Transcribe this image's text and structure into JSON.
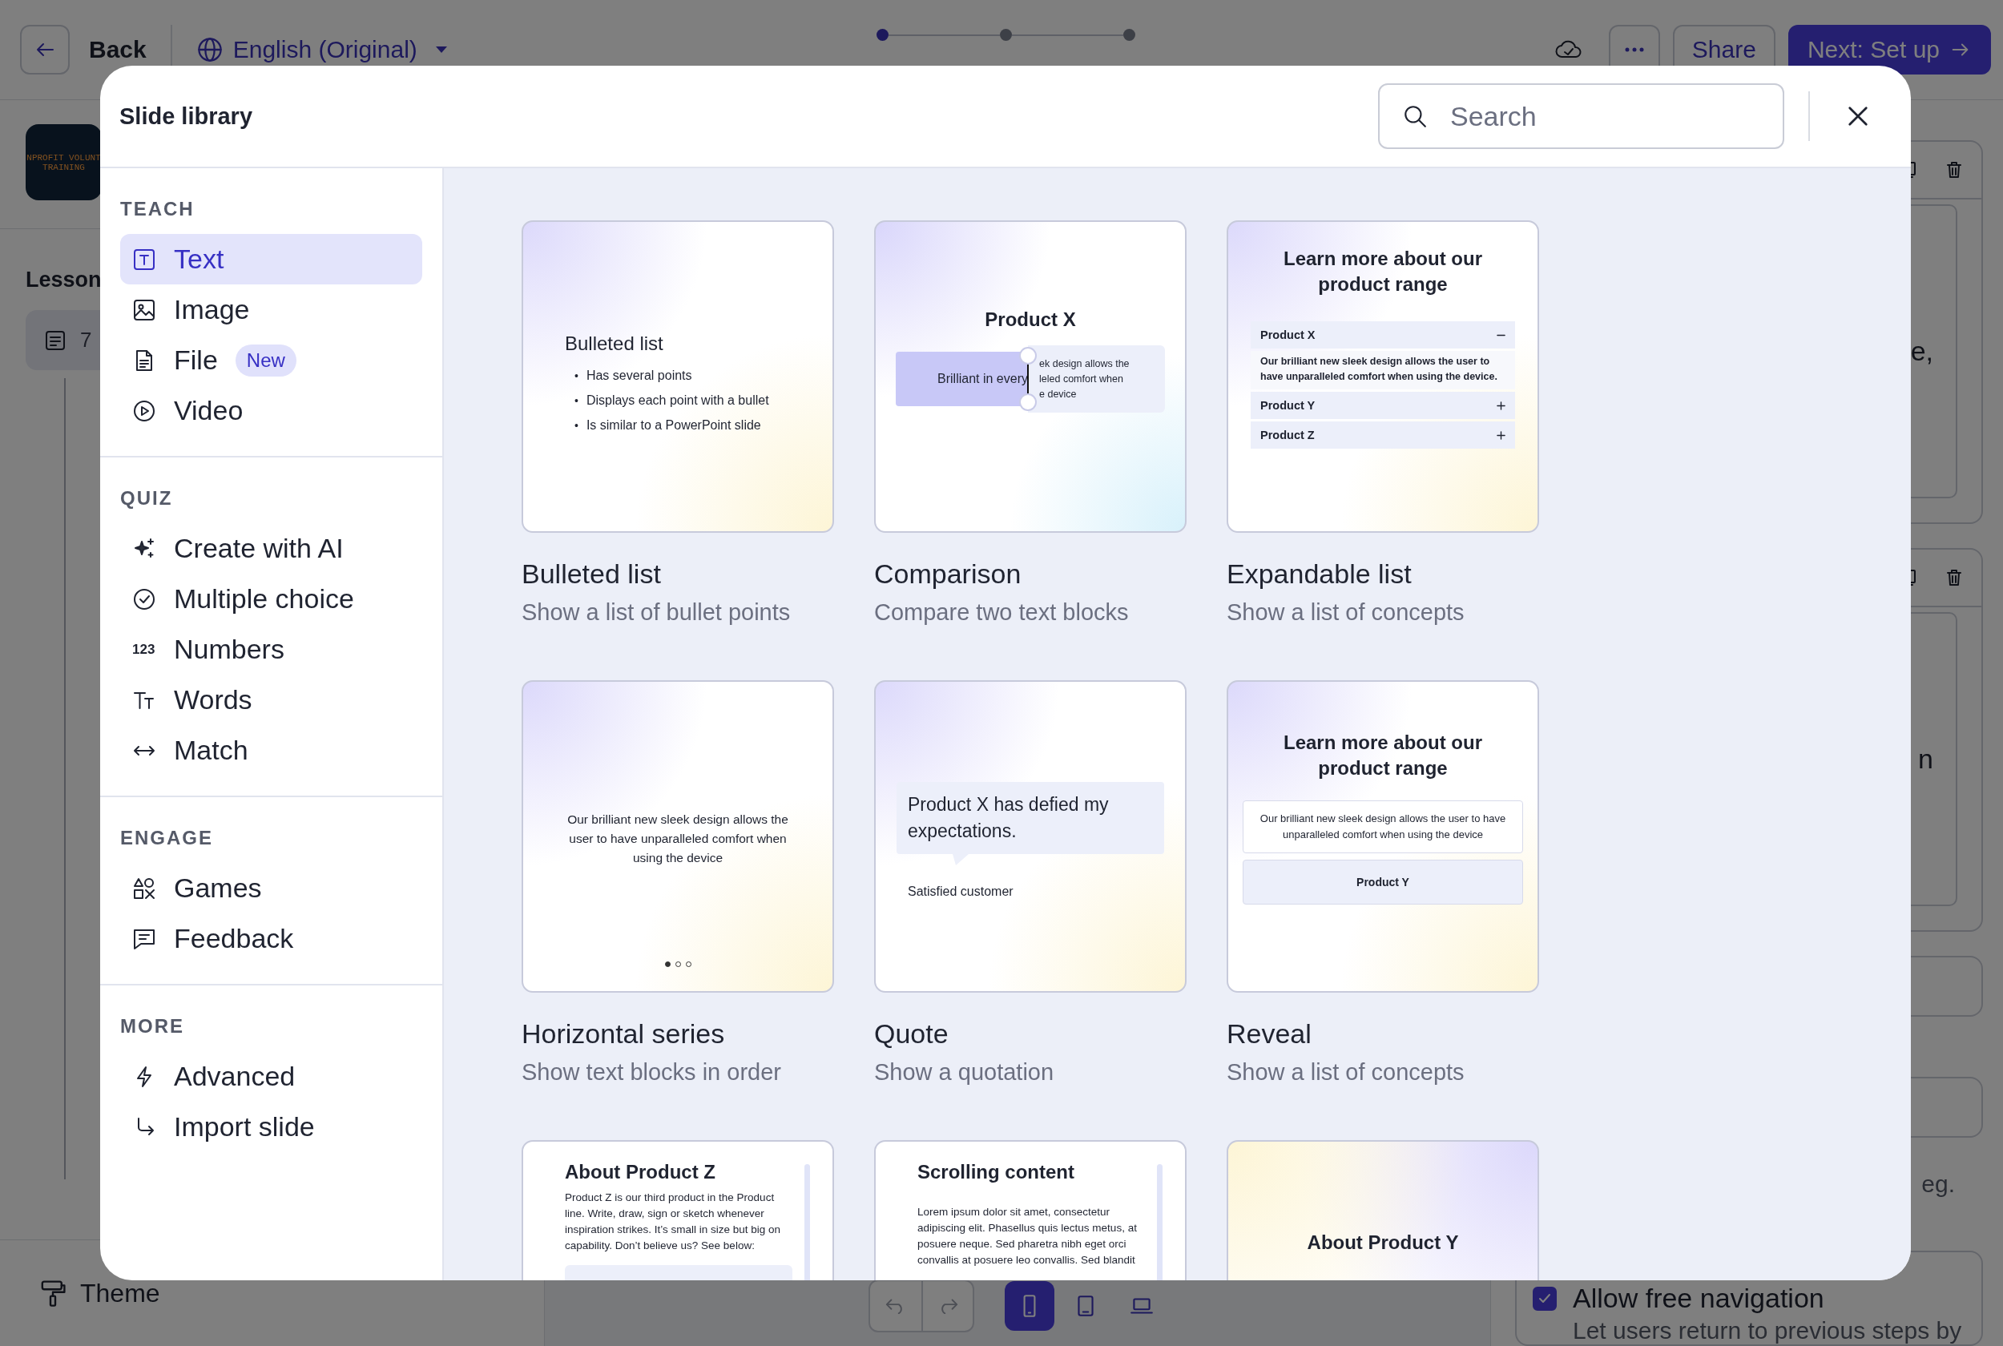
{
  "editor": {
    "back_label": "Back",
    "language": "English (Original)",
    "steps": [
      {
        "selected": true
      },
      {
        "selected": false
      },
      {
        "selected": false
      }
    ],
    "share": "Share",
    "next": "Next: Set up",
    "logo_lines": [
      "NPROFIT VOLUNT",
      "TRAINING"
    ],
    "lesson_heading": "Lesson",
    "lesson_item_number": "7",
    "theme": "Theme",
    "devices": [
      {
        "selected": true
      },
      {
        "selected": false
      },
      {
        "selected": false
      }
    ],
    "right_fragments": [
      "e,",
      "n",
      "eg."
    ],
    "free_navigation": {
      "label": "Allow free navigation",
      "checked": true,
      "description": "Let users return to previous steps by"
    }
  },
  "modal": {
    "title": "Slide library",
    "search": {
      "placeholder": "Search"
    },
    "sections": [
      {
        "heading": "TEACH",
        "items": [
          {
            "label": "Text",
            "selected": true
          },
          {
            "label": "Image",
            "selected": false
          },
          {
            "label": "File",
            "selected": false,
            "badge": "New"
          },
          {
            "label": "Video",
            "selected": false
          }
        ]
      },
      {
        "heading": "QUIZ",
        "items": [
          {
            "label": "Create with AI",
            "selected": false
          },
          {
            "label": "Multiple choice",
            "selected": false
          },
          {
            "label": "Numbers",
            "selected": false,
            "icon_text": "123"
          },
          {
            "label": "Words",
            "selected": false
          },
          {
            "label": "Match",
            "selected": false
          }
        ]
      },
      {
        "heading": "ENGAGE",
        "items": [
          {
            "label": "Games",
            "selected": false
          },
          {
            "label": "Feedback",
            "selected": false
          }
        ]
      },
      {
        "heading": "MORE",
        "items": [
          {
            "label": "Advanced",
            "selected": false
          },
          {
            "label": "Import slide",
            "selected": false
          }
        ]
      }
    ],
    "cards": [
      {
        "title": "Bulleted list",
        "description": "Show a list of bullet points",
        "preview": {
          "kind": "bullets",
          "heading": "Bulleted list",
          "bullet_mark": "•",
          "bullets": [
            "Has several points",
            "Displays each point with a bullet",
            "Is similar to a PowerPoint slide"
          ]
        }
      },
      {
        "title": "Comparison",
        "description": "Compare two text blocks",
        "preview": {
          "kind": "comparison",
          "heading": "Product X",
          "left": "Brilliant in every",
          "right": [
            "ek design allows the",
            "leled comfort when",
            "e device"
          ]
        }
      },
      {
        "title": "Expandable list",
        "description": "Show a list of concepts",
        "preview": {
          "kind": "accordion",
          "heading": "Learn more about our product range",
          "rows": [
            {
              "label": "Product X",
              "expanded": true,
              "body": "Our brilliant new sleek design allows the user to have unparalleled comfort when using the device."
            },
            {
              "label": "Product Y",
              "expanded": false
            },
            {
              "label": "Product Z",
              "expanded": false
            }
          ]
        }
      },
      {
        "title": "Horizontal series",
        "description": "Show text blocks in order",
        "preview": {
          "kind": "series",
          "text": "Our brilliant new sleek design allows the user to have unparalleled comfort when using the device",
          "pages": [
            {
              "selected": true
            },
            {
              "selected": false
            },
            {
              "selected": false
            }
          ]
        }
      },
      {
        "title": "Quote",
        "description": "Show a quotation",
        "preview": {
          "kind": "quote",
          "quote": "Product X has defied my expectations.",
          "author": "Satisfied customer"
        }
      },
      {
        "title": "Reveal",
        "description": "Show a list of concepts",
        "preview": {
          "kind": "reveal",
          "heading": "Learn more about our product range",
          "text": "Our brilliant new sleek design allows the user to have unparalleled comfort when using the device",
          "button": "Product Y"
        }
      },
      {
        "preview": {
          "kind": "article",
          "heading": "About Product Z",
          "text": "Product Z is our third product in the Product line. Write, draw, sign or sketch whenever inspiration strikes. It’s small in size but big on capability. Don’t believe us? See below:"
        }
      },
      {
        "preview": {
          "kind": "scrolling",
          "heading": "Scrolling content",
          "text": "Lorem ipsum dolor sit amet, consectetur adipiscing elit. Phasellus quis lectus metus, at posuere neque. Sed pharetra nibh eget orci convallis at posuere leo convallis. Sed blandit"
        }
      },
      {
        "preview": {
          "kind": "cover",
          "heading": "About Product Y"
        }
      }
    ]
  }
}
